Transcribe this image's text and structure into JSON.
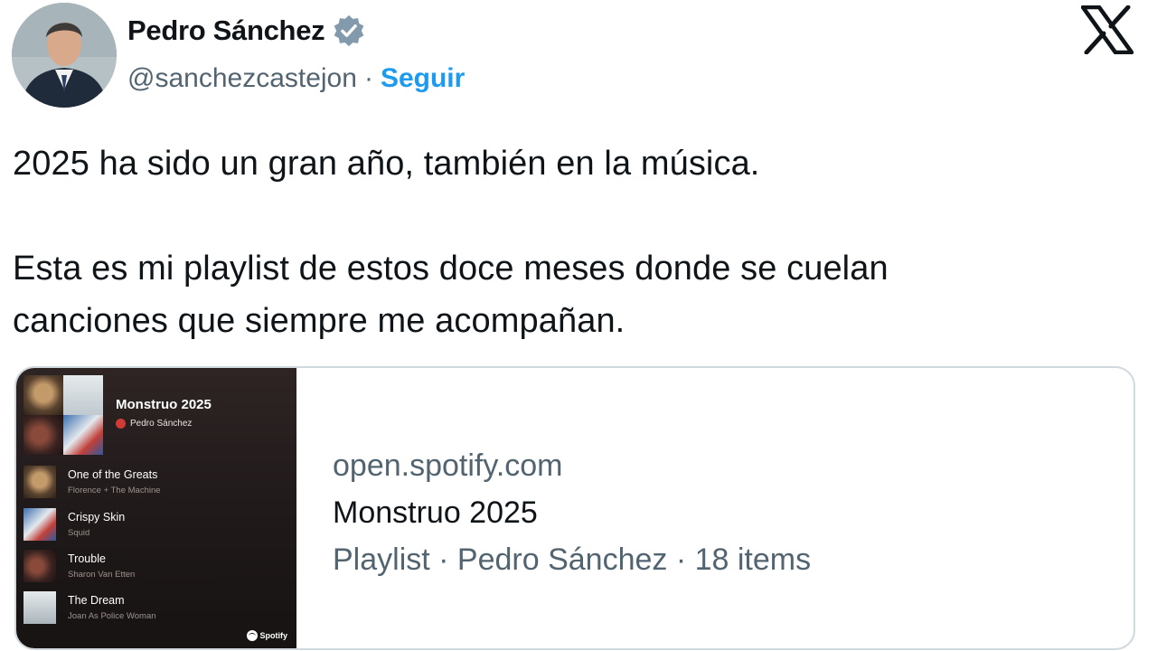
{
  "author": {
    "name": "Pedro Sánchez",
    "handle": "@sanchezcastejon",
    "separator": "·",
    "follow_label": "Seguir",
    "verified_icon": "verified-badge-icon"
  },
  "brand": {
    "logo_icon": "x-logo-icon"
  },
  "tweet": {
    "text": "2025 ha sido un gran año, también en la música.\n\nEsta es mi playlist de estos doce meses donde se cuelan\ncanciones que siempre me acompañan."
  },
  "card": {
    "domain": "open.spotify.com",
    "title": "Monstruo 2025",
    "meta": "Playlist · Pedro Sánchez · 18 items",
    "thumbnail": {
      "playlist_title": "Monstruo 2025",
      "owner": "Pedro Sánchez",
      "tracks": [
        {
          "title": "One of the Greats",
          "artist": "Florence + The Machine"
        },
        {
          "title": "Crispy Skin",
          "artist": "Squid"
        },
        {
          "title": "Trouble",
          "artist": "Sharon Van Etten"
        },
        {
          "title": "The Dream",
          "artist": "Joan As Police Woman"
        }
      ],
      "badge": "Spotify"
    }
  },
  "colors": {
    "link": "#1d9bf0",
    "secondary_text": "#536471",
    "border": "#cfd9de"
  }
}
